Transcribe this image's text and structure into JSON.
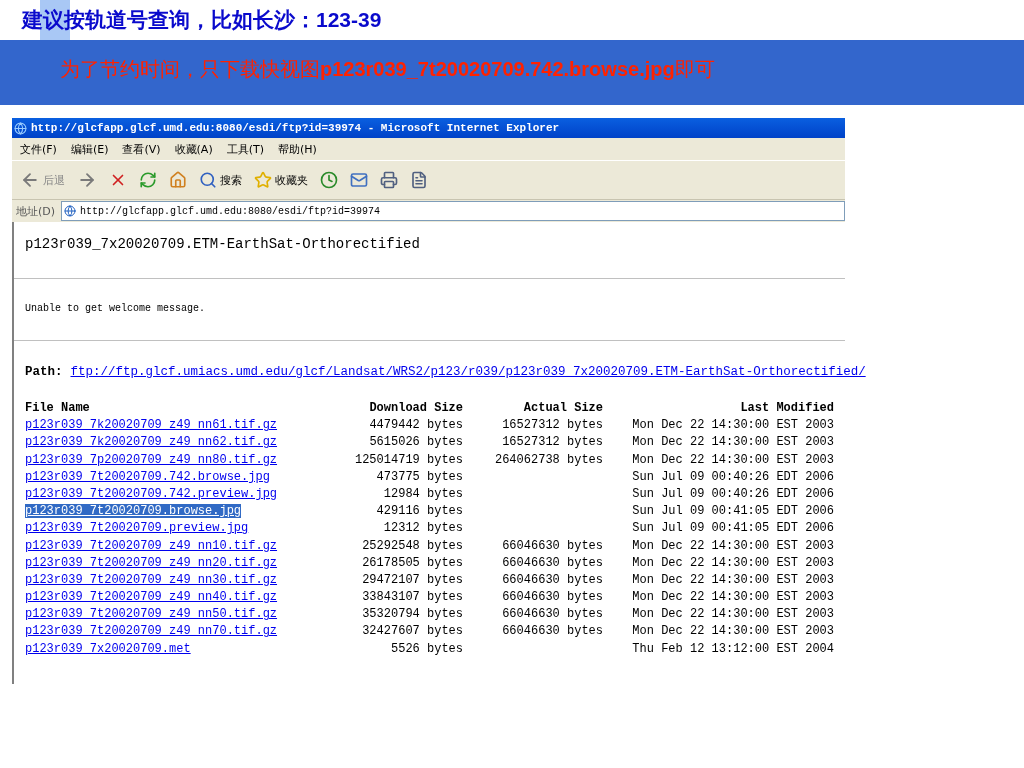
{
  "slide": {
    "title": "建议按轨道号查询，比如长沙：123-39",
    "subtitle": "为了节约时间，只下载快视图**p123r039_7t20020709.742.browse.jpg**即可"
  },
  "browser": {
    "title": "http://glcfapp.glcf.umd.edu:8080/esdi/ftp?id=39974 - Microsoft Internet Explorer",
    "menu": [
      "文件(F)",
      "编辑(E)",
      "查看(V)",
      "收藏(A)",
      "工具(T)",
      "帮助(H)"
    ],
    "toolbar": [
      {
        "kind": "back",
        "label": "后退"
      },
      {
        "kind": "forward"
      },
      {
        "kind": "stop"
      },
      {
        "kind": "refresh"
      },
      {
        "kind": "home"
      },
      {
        "kind": "search",
        "label": "搜索"
      },
      {
        "kind": "favorites",
        "label": "收藏夹"
      },
      {
        "kind": "history"
      },
      {
        "kind": "mail"
      },
      {
        "kind": "print"
      },
      {
        "kind": "edit"
      }
    ],
    "address": {
      "label": "地址(D)",
      "value": "http://glcfapp.glcf.umd.edu:8080/esdi/ftp?id=39974"
    },
    "page": {
      "heading": "p123r039_7x20020709.ETM-EarthSat-Orthorectified",
      "message": "Unable to get welcome message.",
      "path_label": "Path:",
      "path_link": "ftp://ftp.glcf.umiacs.umd.edu/glcf/Landsat/WRS2/p123/r039/p123r039_7x20020709.ETM-EarthSat-Orthorectified/",
      "columns": [
        "File Name",
        "Download Size",
        "Actual Size",
        "Last Modified"
      ],
      "rows": [
        {
          "file": "p123r039_7k20020709_z49_nn61.tif.gz",
          "download_size": "4479442 bytes",
          "actual_size": "16527312 bytes",
          "last_modified": "Mon Dec 22 14:30:00 EST 2003",
          "selected": false
        },
        {
          "file": "p123r039_7k20020709_z49_nn62.tif.gz",
          "download_size": "5615026 bytes",
          "actual_size": "16527312 bytes",
          "last_modified": "Mon Dec 22 14:30:00 EST 2003",
          "selected": false
        },
        {
          "file": "p123r039_7p20020709_z49_nn80.tif.gz",
          "download_size": "125014719 bytes",
          "actual_size": "264062738 bytes",
          "last_modified": "Mon Dec 22 14:30:00 EST 2003",
          "selected": false
        },
        {
          "file": "p123r039_7t20020709.742.browse.jpg",
          "download_size": "473775 bytes",
          "last_modified": "Sun Jul 09 00:40:26 EDT 2006",
          "selected": false
        },
        {
          "file": "p123r039_7t20020709.742.preview.jpg",
          "download_size": "12984 bytes",
          "last_modified": "Sun Jul 09 00:40:26 EDT 2006",
          "selected": false
        },
        {
          "file": "p123r039_7t20020709.browse.jpg",
          "download_size": "429116 bytes",
          "last_modified": "Sun Jul 09 00:41:05 EDT 2006",
          "selected": true
        },
        {
          "file": "p123r039_7t20020709.preview.jpg",
          "download_size": "12312 bytes",
          "last_modified": "Sun Jul 09 00:41:05 EDT 2006",
          "selected": false
        },
        {
          "file": "p123r039_7t20020709_z49_nn10.tif.gz",
          "download_size": "25292548 bytes",
          "actual_size": "66046630 bytes",
          "last_modified": "Mon Dec 22 14:30:00 EST 2003",
          "selected": false
        },
        {
          "file": "p123r039_7t20020709_z49_nn20.tif.gz",
          "download_size": "26178505 bytes",
          "actual_size": "66046630 bytes",
          "last_modified": "Mon Dec 22 14:30:00 EST 2003",
          "selected": false
        },
        {
          "file": "p123r039_7t20020709_z49_nn30.tif.gz",
          "download_size": "29472107 bytes",
          "actual_size": "66046630 bytes",
          "last_modified": "Mon Dec 22 14:30:00 EST 2003",
          "selected": false
        },
        {
          "file": "p123r039_7t20020709_z49_nn40.tif.gz",
          "download_size": "33843107 bytes",
          "actual_size": "66046630 bytes",
          "last_modified": "Mon Dec 22 14:30:00 EST 2003",
          "selected": false
        },
        {
          "file": "p123r039_7t20020709_z49_nn50.tif.gz",
          "download_size": "35320794 bytes",
          "actual_size": "66046630 bytes",
          "last_modified": "Mon Dec 22 14:30:00 EST 2003",
          "selected": false
        },
        {
          "file": "p123r039_7t20020709_z49_nn70.tif.gz",
          "download_size": "32427607 bytes",
          "actual_size": "66046630 bytes",
          "last_modified": "Mon Dec 22 14:30:00 EST 2003",
          "selected": false
        },
        {
          "file": "p123r039_7x20020709.met",
          "download_size": "5526 bytes",
          "last_modified": "Thu Feb 12 13:12:00 EST 2004",
          "selected": false
        }
      ]
    }
  }
}
